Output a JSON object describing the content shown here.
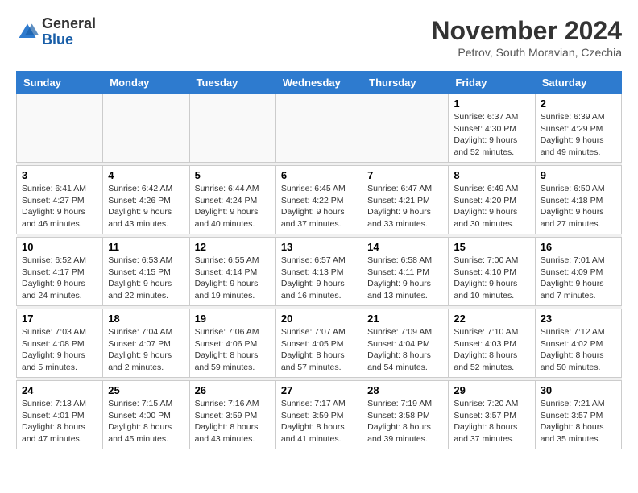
{
  "logo": {
    "general": "General",
    "blue": "Blue"
  },
  "header": {
    "month_title": "November 2024",
    "subtitle": "Petrov, South Moravian, Czechia"
  },
  "weekdays": [
    "Sunday",
    "Monday",
    "Tuesday",
    "Wednesday",
    "Thursday",
    "Friday",
    "Saturday"
  ],
  "weeks": [
    [
      {
        "day": "",
        "info": ""
      },
      {
        "day": "",
        "info": ""
      },
      {
        "day": "",
        "info": ""
      },
      {
        "day": "",
        "info": ""
      },
      {
        "day": "",
        "info": ""
      },
      {
        "day": "1",
        "info": "Sunrise: 6:37 AM\nSunset: 4:30 PM\nDaylight: 9 hours\nand 52 minutes."
      },
      {
        "day": "2",
        "info": "Sunrise: 6:39 AM\nSunset: 4:29 PM\nDaylight: 9 hours\nand 49 minutes."
      }
    ],
    [
      {
        "day": "3",
        "info": "Sunrise: 6:41 AM\nSunset: 4:27 PM\nDaylight: 9 hours\nand 46 minutes."
      },
      {
        "day": "4",
        "info": "Sunrise: 6:42 AM\nSunset: 4:26 PM\nDaylight: 9 hours\nand 43 minutes."
      },
      {
        "day": "5",
        "info": "Sunrise: 6:44 AM\nSunset: 4:24 PM\nDaylight: 9 hours\nand 40 minutes."
      },
      {
        "day": "6",
        "info": "Sunrise: 6:45 AM\nSunset: 4:22 PM\nDaylight: 9 hours\nand 37 minutes."
      },
      {
        "day": "7",
        "info": "Sunrise: 6:47 AM\nSunset: 4:21 PM\nDaylight: 9 hours\nand 33 minutes."
      },
      {
        "day": "8",
        "info": "Sunrise: 6:49 AM\nSunset: 4:20 PM\nDaylight: 9 hours\nand 30 minutes."
      },
      {
        "day": "9",
        "info": "Sunrise: 6:50 AM\nSunset: 4:18 PM\nDaylight: 9 hours\nand 27 minutes."
      }
    ],
    [
      {
        "day": "10",
        "info": "Sunrise: 6:52 AM\nSunset: 4:17 PM\nDaylight: 9 hours\nand 24 minutes."
      },
      {
        "day": "11",
        "info": "Sunrise: 6:53 AM\nSunset: 4:15 PM\nDaylight: 9 hours\nand 22 minutes."
      },
      {
        "day": "12",
        "info": "Sunrise: 6:55 AM\nSunset: 4:14 PM\nDaylight: 9 hours\nand 19 minutes."
      },
      {
        "day": "13",
        "info": "Sunrise: 6:57 AM\nSunset: 4:13 PM\nDaylight: 9 hours\nand 16 minutes."
      },
      {
        "day": "14",
        "info": "Sunrise: 6:58 AM\nSunset: 4:11 PM\nDaylight: 9 hours\nand 13 minutes."
      },
      {
        "day": "15",
        "info": "Sunrise: 7:00 AM\nSunset: 4:10 PM\nDaylight: 9 hours\nand 10 minutes."
      },
      {
        "day": "16",
        "info": "Sunrise: 7:01 AM\nSunset: 4:09 PM\nDaylight: 9 hours\nand 7 minutes."
      }
    ],
    [
      {
        "day": "17",
        "info": "Sunrise: 7:03 AM\nSunset: 4:08 PM\nDaylight: 9 hours\nand 5 minutes."
      },
      {
        "day": "18",
        "info": "Sunrise: 7:04 AM\nSunset: 4:07 PM\nDaylight: 9 hours\nand 2 minutes."
      },
      {
        "day": "19",
        "info": "Sunrise: 7:06 AM\nSunset: 4:06 PM\nDaylight: 8 hours\nand 59 minutes."
      },
      {
        "day": "20",
        "info": "Sunrise: 7:07 AM\nSunset: 4:05 PM\nDaylight: 8 hours\nand 57 minutes."
      },
      {
        "day": "21",
        "info": "Sunrise: 7:09 AM\nSunset: 4:04 PM\nDaylight: 8 hours\nand 54 minutes."
      },
      {
        "day": "22",
        "info": "Sunrise: 7:10 AM\nSunset: 4:03 PM\nDaylight: 8 hours\nand 52 minutes."
      },
      {
        "day": "23",
        "info": "Sunrise: 7:12 AM\nSunset: 4:02 PM\nDaylight: 8 hours\nand 50 minutes."
      }
    ],
    [
      {
        "day": "24",
        "info": "Sunrise: 7:13 AM\nSunset: 4:01 PM\nDaylight: 8 hours\nand 47 minutes."
      },
      {
        "day": "25",
        "info": "Sunrise: 7:15 AM\nSunset: 4:00 PM\nDaylight: 8 hours\nand 45 minutes."
      },
      {
        "day": "26",
        "info": "Sunrise: 7:16 AM\nSunset: 3:59 PM\nDaylight: 8 hours\nand 43 minutes."
      },
      {
        "day": "27",
        "info": "Sunrise: 7:17 AM\nSunset: 3:59 PM\nDaylight: 8 hours\nand 41 minutes."
      },
      {
        "day": "28",
        "info": "Sunrise: 7:19 AM\nSunset: 3:58 PM\nDaylight: 8 hours\nand 39 minutes."
      },
      {
        "day": "29",
        "info": "Sunrise: 7:20 AM\nSunset: 3:57 PM\nDaylight: 8 hours\nand 37 minutes."
      },
      {
        "day": "30",
        "info": "Sunrise: 7:21 AM\nSunset: 3:57 PM\nDaylight: 8 hours\nand 35 minutes."
      }
    ]
  ]
}
